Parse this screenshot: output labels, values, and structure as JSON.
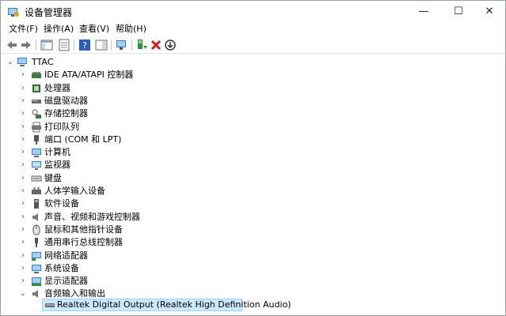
{
  "window": {
    "title": "设备管理器"
  },
  "menu": [
    "文件(F)",
    "操作(A)",
    "查看(V)",
    "帮助(H)"
  ],
  "tree": {
    "root": "TTAC",
    "categories": [
      {
        "label": "IDE ATA/ATAPI 控制器",
        "icon": "ide-controller-icon"
      },
      {
        "label": "处理器",
        "icon": "processor-icon"
      },
      {
        "label": "磁盘驱动器",
        "icon": "disk-drive-icon"
      },
      {
        "label": "存储控制器",
        "icon": "storage-controller-icon"
      },
      {
        "label": "打印队列",
        "icon": "printer-icon"
      },
      {
        "label": "端口 (COM 和 LPT)",
        "icon": "port-icon"
      },
      {
        "label": "计算机",
        "icon": "computer-icon"
      },
      {
        "label": "监视器",
        "icon": "monitor-icon"
      },
      {
        "label": "键盘",
        "icon": "keyboard-icon"
      },
      {
        "label": "人体学输入设备",
        "icon": "hid-icon"
      },
      {
        "label": "软件设备",
        "icon": "software-device-icon"
      },
      {
        "label": "声音、视频和游戏控制器",
        "icon": "sound-icon"
      },
      {
        "label": "鼠标和其他指针设备",
        "icon": "mouse-icon"
      },
      {
        "label": "通用串行总线控制器",
        "icon": "usb-icon"
      },
      {
        "label": "网络适配器",
        "icon": "network-adapter-icon"
      },
      {
        "label": "系统设备",
        "icon": "system-device-icon"
      },
      {
        "label": "显示适配器",
        "icon": "display-adapter-icon"
      },
      {
        "label": "音频输入和输出",
        "icon": "audio-io-icon"
      }
    ],
    "selected_child": "Realtek Digital Output (Realtek High Definition Audio)"
  }
}
